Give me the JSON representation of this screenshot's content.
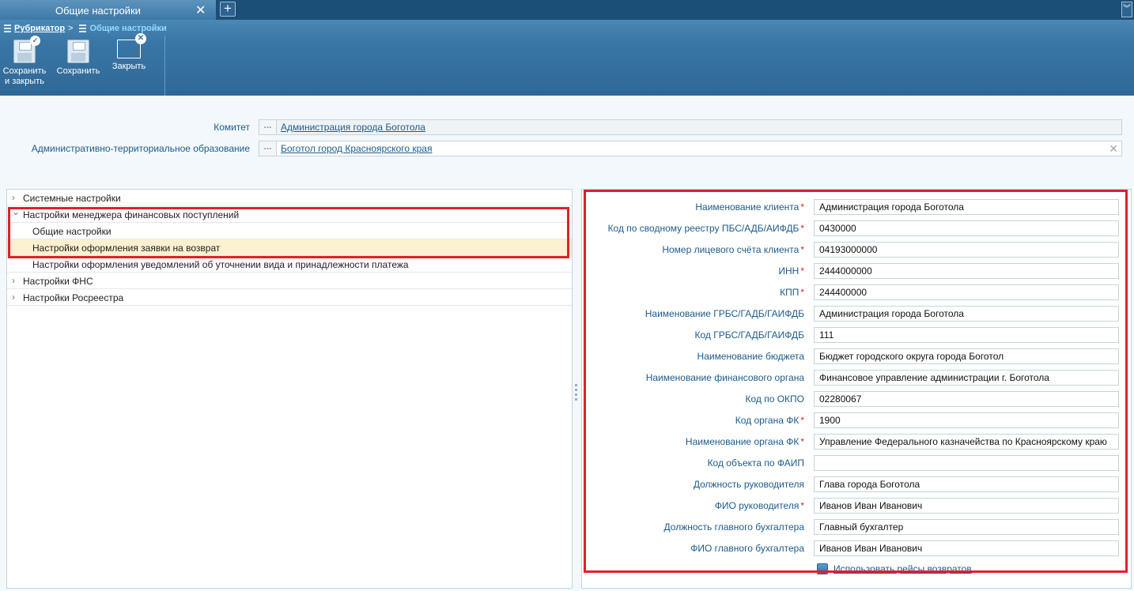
{
  "tab": {
    "title": "Общие настройки",
    "close": "✕",
    "add": "+",
    "menu": "︾"
  },
  "breadcrumb": {
    "root": "Рубрикатор",
    "separator": ">",
    "current": "Общие настройки"
  },
  "toolbar": {
    "save_close": "Сохранить и закрыть",
    "save": "Сохранить",
    "close": "Закрыть"
  },
  "header": {
    "committee_label": "Комитет",
    "committee_value": "Администрация города Боготола",
    "ato_label": "Административно-территориальное образование",
    "ato_value": "Боготол город Красноярского края",
    "ref_button": "...",
    "clear": "✕"
  },
  "tree": {
    "items": [
      {
        "label": "Системные настройки",
        "arrow": "›"
      },
      {
        "label": "Настройки менеджера финансовых поступлений",
        "arrow": "⌄"
      },
      {
        "label": "Общие настройки"
      },
      {
        "label": "Настройки оформления заявки на возврат"
      },
      {
        "label": "Настройки оформления уведомлений об уточнении вида и принадлежности платежа"
      },
      {
        "label": "Настройки ФНС",
        "arrow": "›"
      },
      {
        "label": "Настройки Росреестра",
        "arrow": "›"
      }
    ]
  },
  "form": {
    "required_mark": "*",
    "fields": [
      {
        "label": "Наименование клиента",
        "required": true,
        "value": "Администрация города Боготола"
      },
      {
        "label": "Код по сводному реестру ПБС/АДБ/АИФДБ",
        "required": true,
        "value": "0430000"
      },
      {
        "label": "Номер лицевого счёта клиента",
        "required": true,
        "value": "04193000000"
      },
      {
        "label": "ИНН",
        "required": true,
        "value": "2444000000"
      },
      {
        "label": "КПП",
        "required": true,
        "value": "244400000"
      },
      {
        "label": "Наименование ГРБС/ГАДБ/ГАИФДБ",
        "required": false,
        "value": "Администрация города Боготола"
      },
      {
        "label": "Код ГРБС/ГАДБ/ГАИФДБ",
        "required": false,
        "value": "111"
      },
      {
        "label": "Наименование бюджета",
        "required": false,
        "value": "Бюджет городского округа города Боготол"
      },
      {
        "label": "Наименование финансового органа",
        "required": false,
        "value": "Финансовое управление администрации г. Боготола"
      },
      {
        "label": "Код по ОКПО",
        "required": false,
        "value": "02280067"
      },
      {
        "label": "Код органа ФК",
        "required": true,
        "value": "1900"
      },
      {
        "label": "Наименование органа ФК",
        "required": true,
        "value": "Управление Федерального казначейства по Красноярскому краю"
      },
      {
        "label": "Код объекта по ФАИП",
        "required": false,
        "value": ""
      },
      {
        "label": "Должность руководителя",
        "required": false,
        "value": "Глава города Боготола"
      },
      {
        "label": "ФИО руководителя",
        "required": true,
        "value": "Иванов Иван Иванович"
      },
      {
        "label": "Должность главного бухгалтера",
        "required": false,
        "value": "Главный бухгалтер"
      },
      {
        "label": "ФИО главного бухгалтера",
        "required": false,
        "value": "Иванов Иван Иванович"
      }
    ],
    "checkbox_label": "Использовать рейсы возвратов"
  },
  "colors": {
    "highlight_border": "#e0202a",
    "selected_row": "#fbf0cf",
    "label": "#1e5b8a"
  }
}
